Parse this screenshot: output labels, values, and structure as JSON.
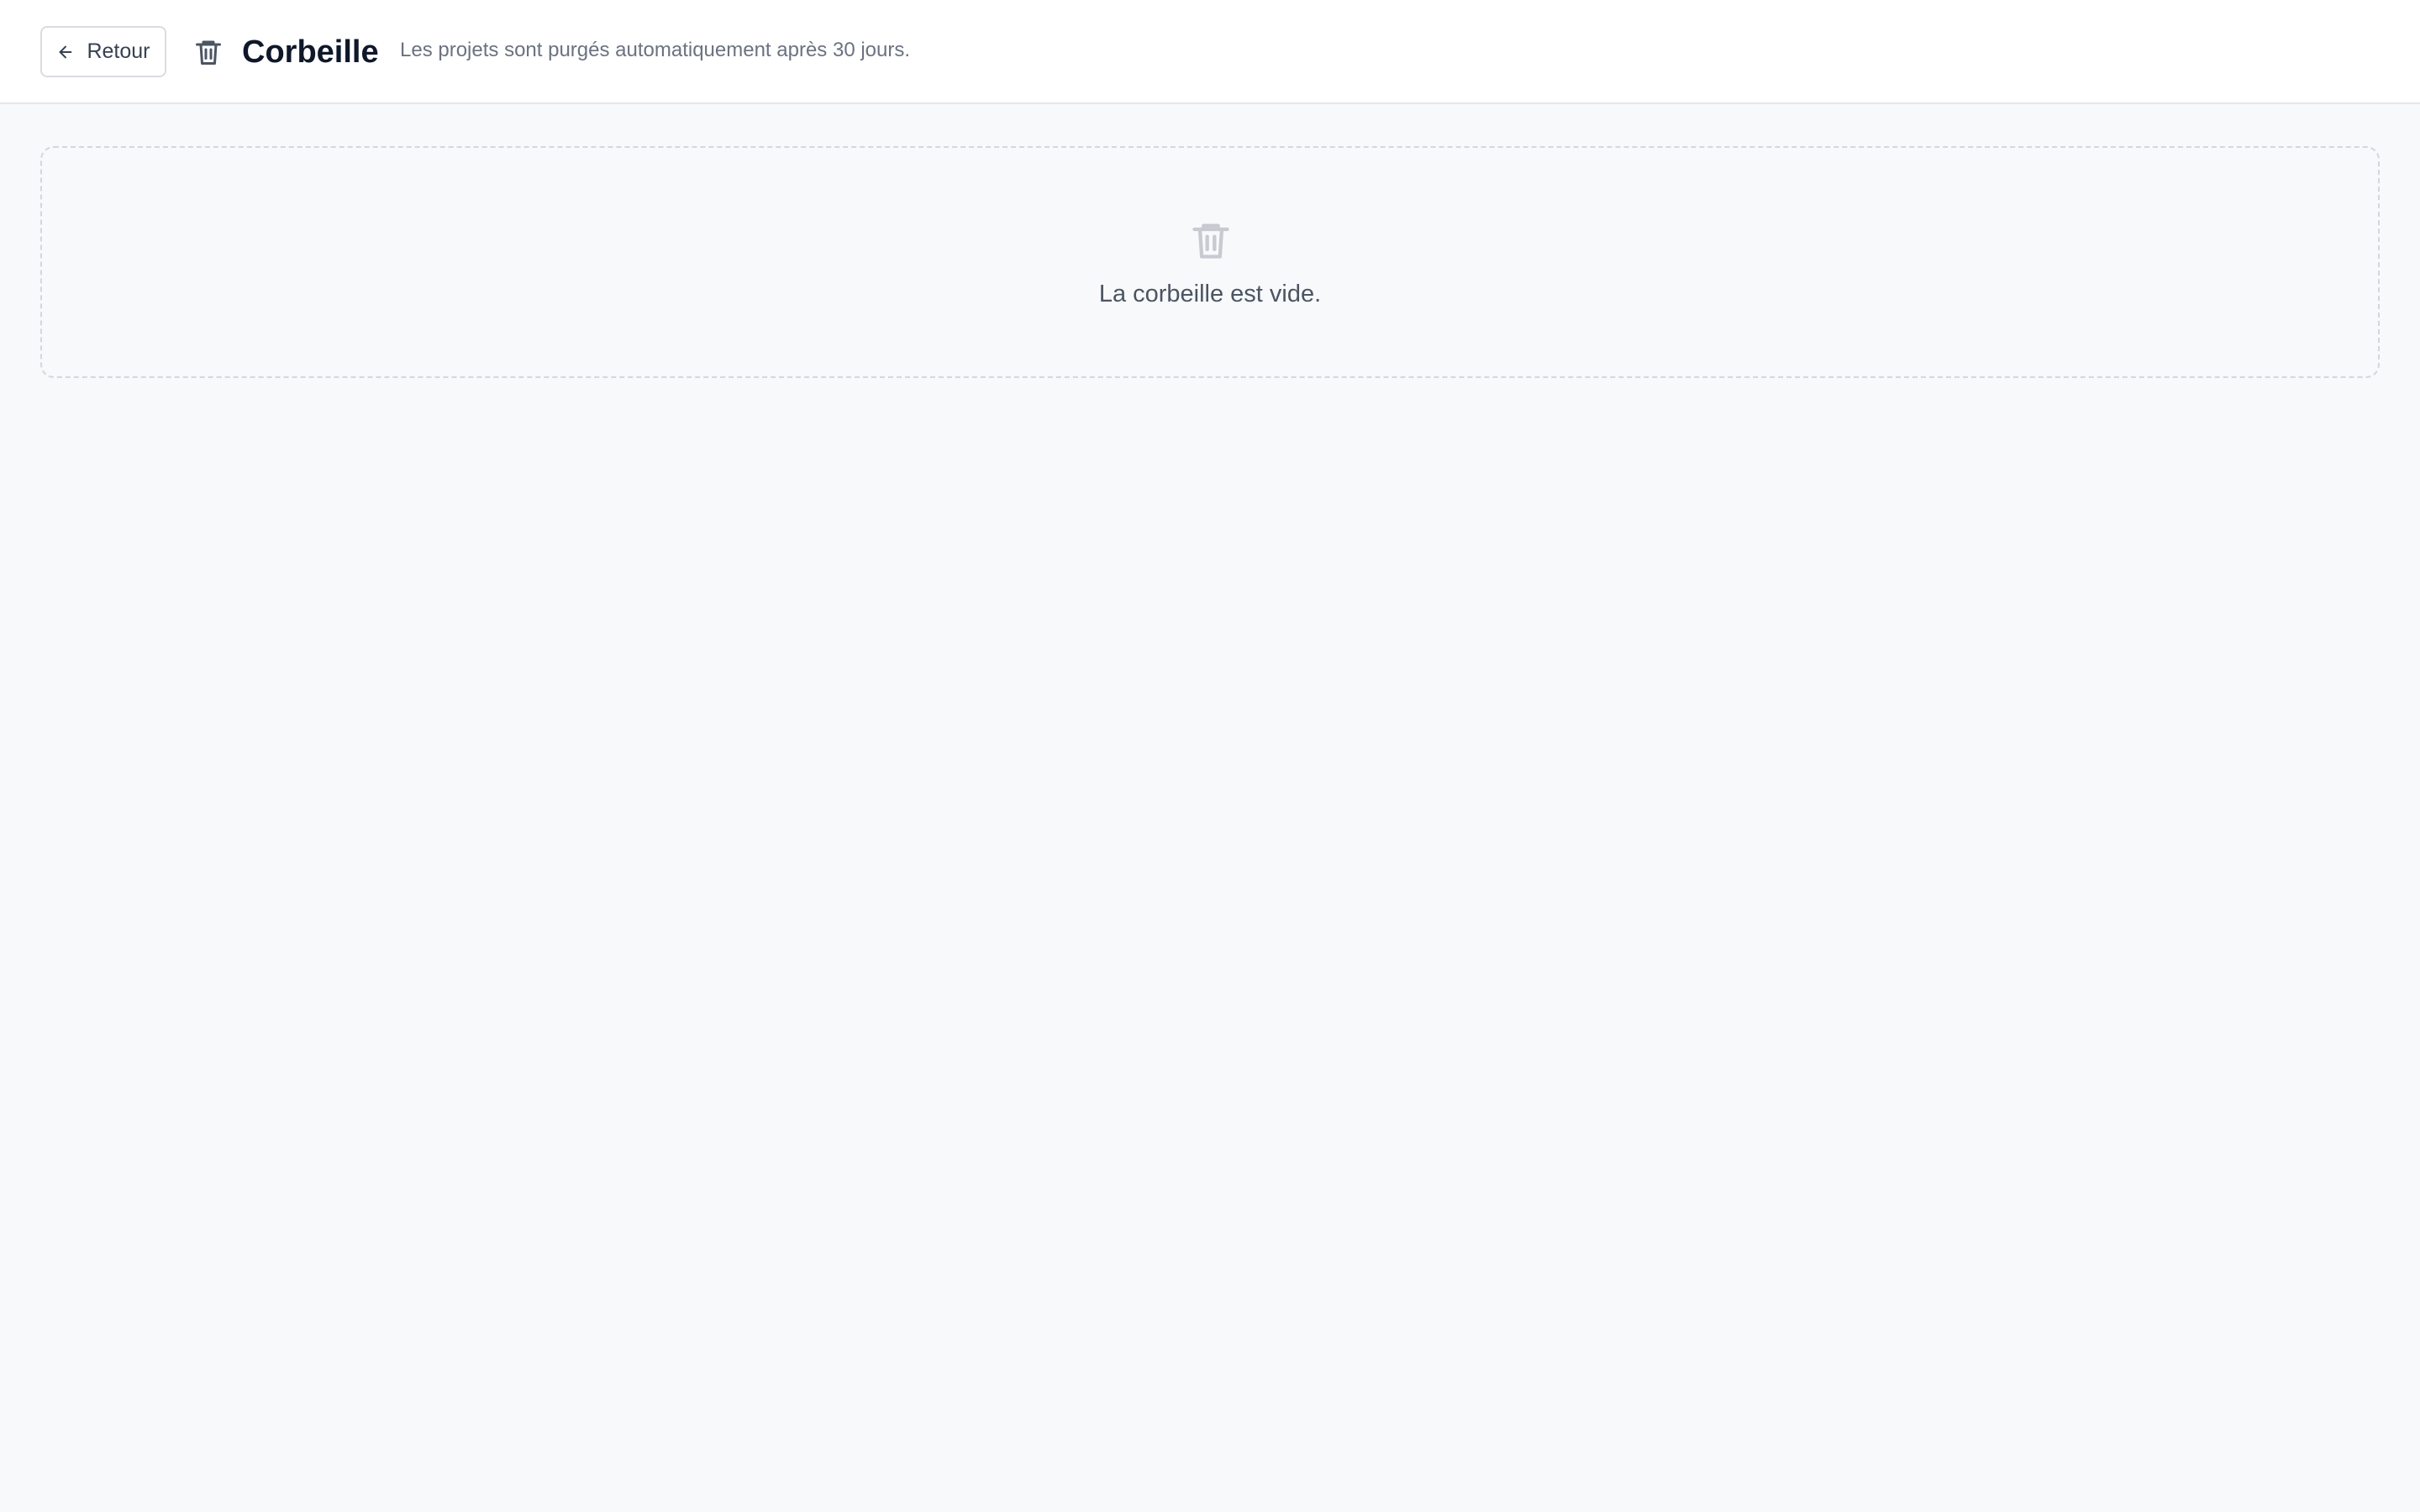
{
  "header": {
    "back_button_label": "Retour",
    "back_icon": "arrow-left-icon",
    "title_icon": "trash-icon",
    "title": "Corbeille",
    "subtitle": "Les projets sont purgés automatiquement après 30 jours."
  },
  "empty_state": {
    "icon": "trash-icon",
    "message": "La corbeille est vide."
  },
  "colors": {
    "background": "#f8f9fb",
    "header_background": "#ffffff",
    "title": "#0f172a",
    "muted_text": "#6b7280",
    "icon_muted": "#c7cbd1"
  }
}
